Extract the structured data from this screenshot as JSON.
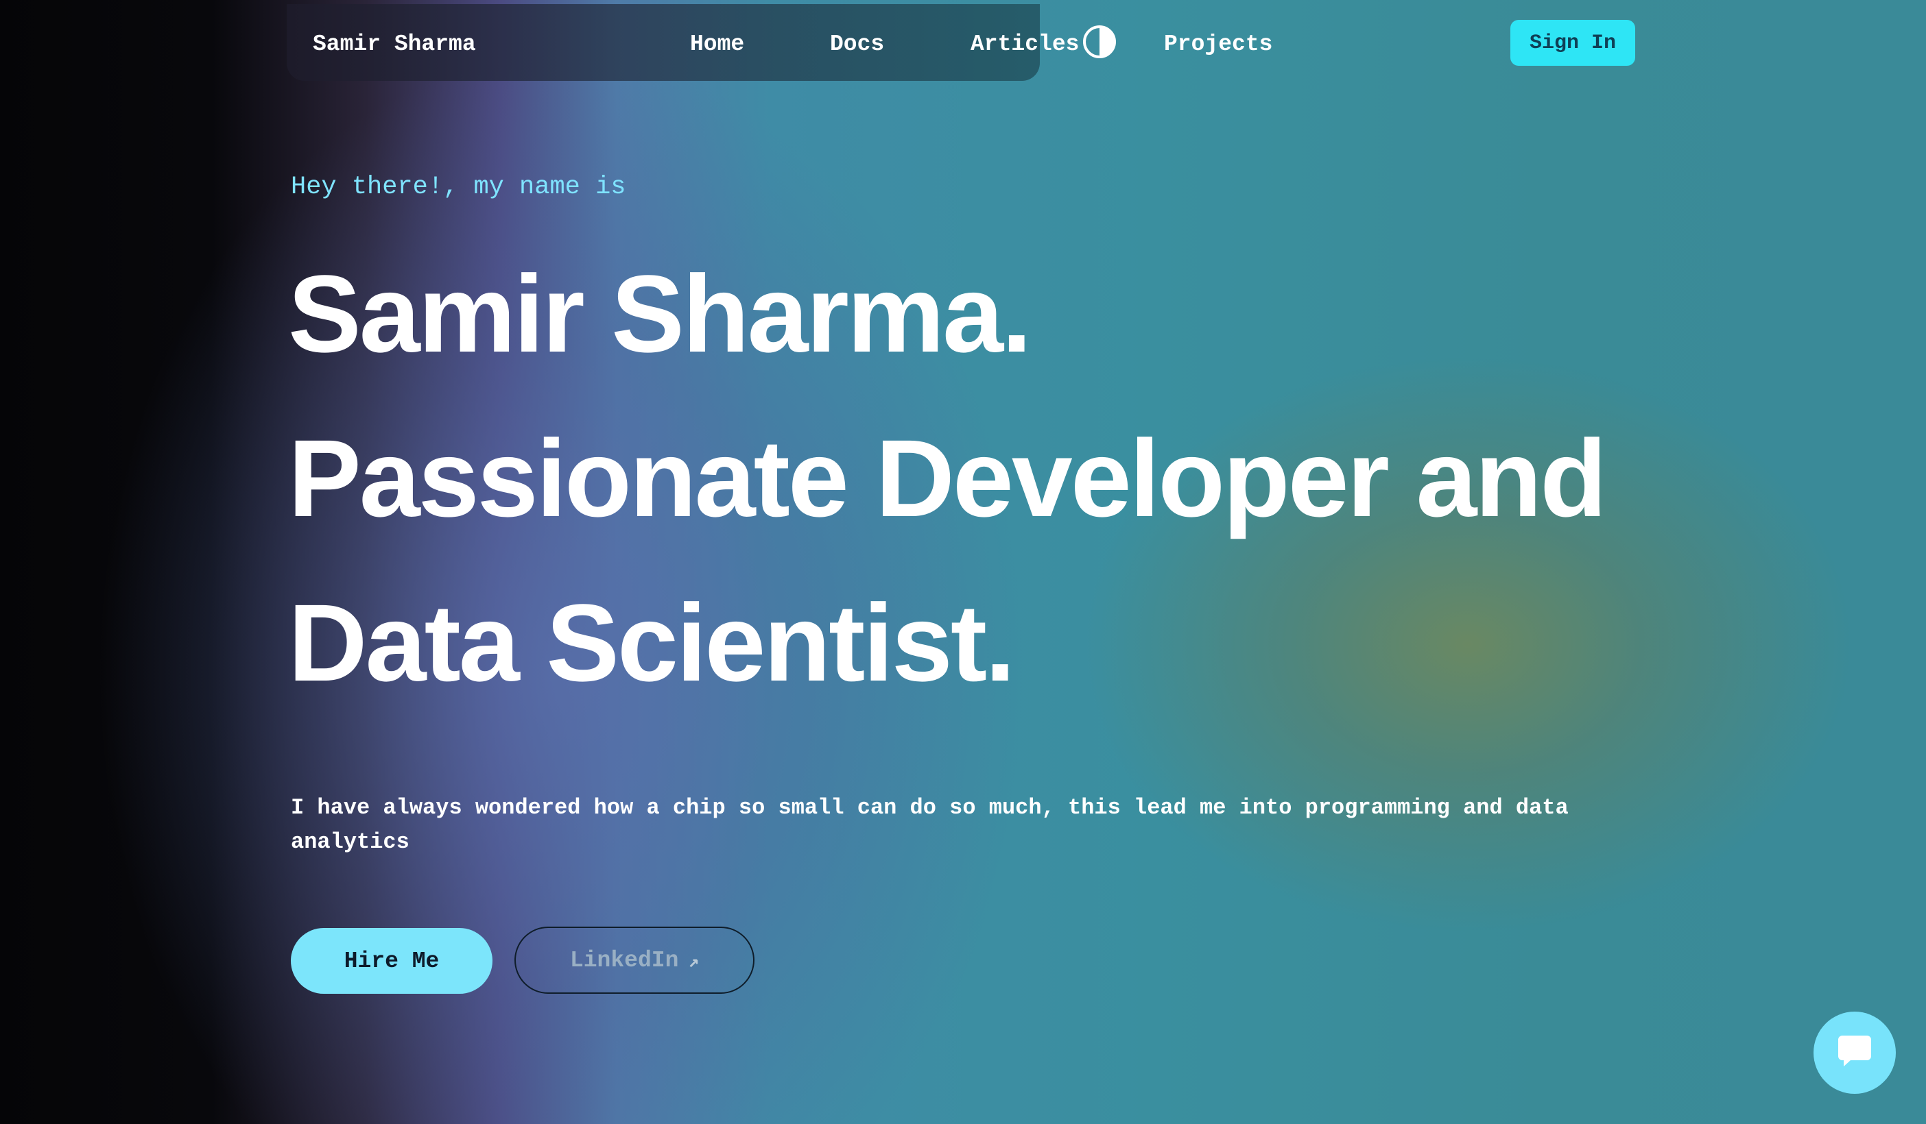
{
  "nav": {
    "brand": "Samir Sharma",
    "links": [
      "Home",
      "Docs",
      "Articles",
      "Projects"
    ],
    "theme_toggle_icon": "contrast-icon",
    "sign_in_label": "Sign In"
  },
  "hero": {
    "greeting": "Hey there!, my name is",
    "name_line": "Samir Sharma.",
    "title_line_1": "Passionate Developer and",
    "title_line_2": "Data Scientist.",
    "description": "I have always wondered how a chip so small can do so much, this lead me into programming and data analytics",
    "hire_label": "Hire Me",
    "linkedin_label": "LinkedIn",
    "linkedin_icon": "arrow-up-right-icon"
  },
  "chat": {
    "icon": "chat-bubble-icon"
  },
  "colors": {
    "accent_cyan": "#2ee5f5",
    "greeting_text": "#7fe3ff",
    "hire_button": "#7ce5fb"
  }
}
